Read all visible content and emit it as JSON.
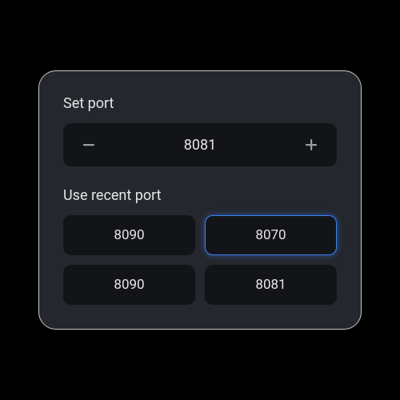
{
  "setPort": {
    "label": "Set port",
    "value": "8081"
  },
  "recent": {
    "label": "Use recent port",
    "items": [
      {
        "port": "8090",
        "selected": false
      },
      {
        "port": "8070",
        "selected": true
      },
      {
        "port": "8090",
        "selected": false
      },
      {
        "port": "8081",
        "selected": false
      }
    ]
  }
}
